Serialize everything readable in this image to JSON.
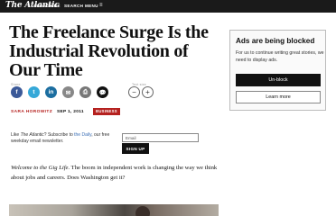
{
  "header": {
    "logo": "The Atlantic",
    "nav": {
      "subscribe": "SUBSCRIBE",
      "search": "SEARCH",
      "menu": "MENU"
    },
    "menu_glyph": "≡"
  },
  "article": {
    "headline": "The Freelance Surge Is the Industrial Revolution of Our Time",
    "share_label": "Share",
    "text_size_label": "Text size",
    "author": "SARA HOROWITZ",
    "date": "SEP 1, 2011",
    "section_tag": "BUSINESS",
    "lede_em": "Welcome to the Gig Life.",
    "lede_rest": " The boom in independent work is changing the way we think about jobs and careers. Does Washington get it?"
  },
  "share_buttons": {
    "facebook": "f",
    "twitter": "t",
    "linkedin": "in",
    "email": "✉",
    "print": "⎙",
    "comments": "💬"
  },
  "text_size": {
    "decrease": "−",
    "increase": "+"
  },
  "newsletter": {
    "text_like": "Like ",
    "text_mag": "The Atlantic",
    "text_mid": "? Subscribe to ",
    "text_link": "the Daily",
    "text_end": ", our free weekday email newsletter.",
    "email_placeholder": "Email",
    "signup_label": "SIGN UP"
  },
  "ad_block": {
    "title": "Ads are being blocked",
    "message": "For us to continue writing great stories, we need to display ads.",
    "unblock_label": "Un-block",
    "learn_more_label": "Learn more"
  },
  "colors": {
    "accent_red": "#b5211f",
    "facebook": "#3b5998",
    "twitter": "#35a8d8",
    "linkedin": "#1c6ea0"
  }
}
